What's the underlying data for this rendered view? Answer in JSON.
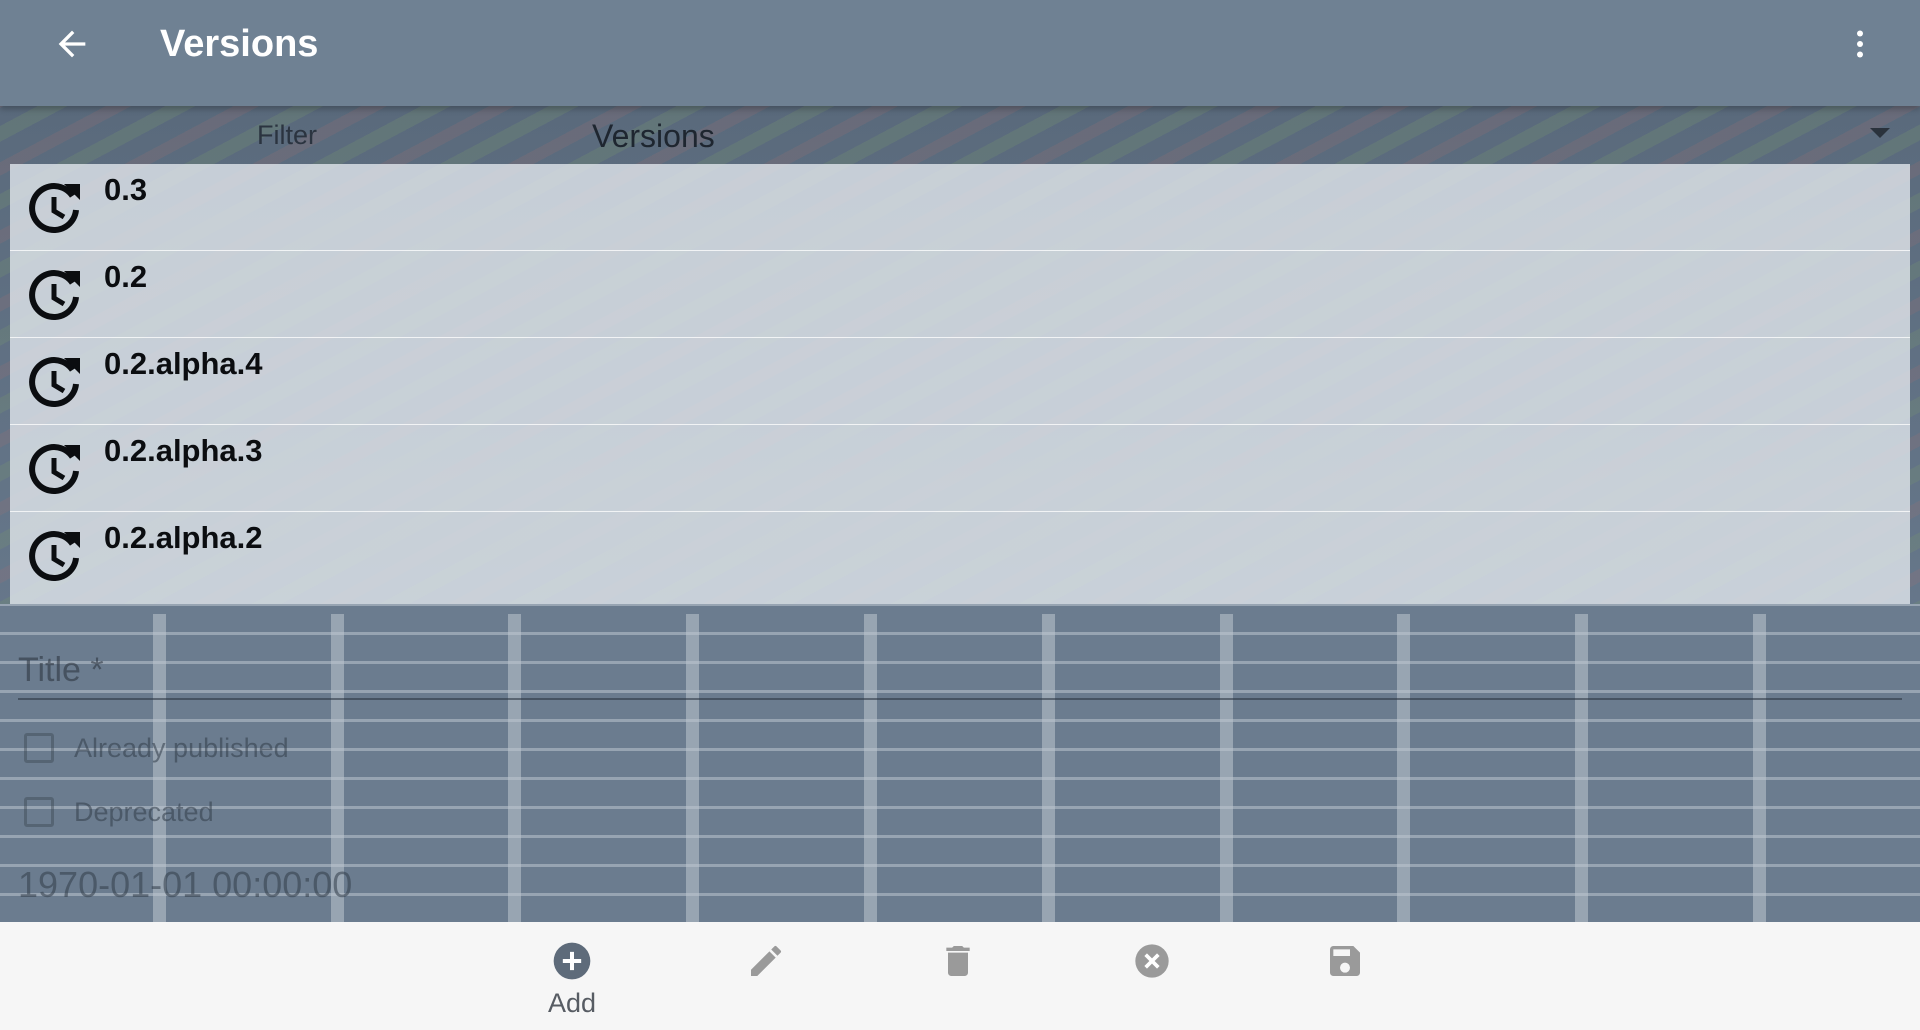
{
  "appbar": {
    "title": "Versions",
    "back_icon": "arrow-back-icon",
    "more_icon": "more-vert-icon"
  },
  "filter": {
    "label": "Filter",
    "selected": "Versions"
  },
  "versions": [
    {
      "label": "0.3",
      "icon": "history-icon"
    },
    {
      "label": "0.2",
      "icon": "history-icon"
    },
    {
      "label": "0.2.alpha.4",
      "icon": "history-icon"
    },
    {
      "label": "0.2.alpha.3",
      "icon": "history-icon"
    },
    {
      "label": "0.2.alpha.2",
      "icon": "history-icon"
    }
  ],
  "form": {
    "title_placeholder": "Title *",
    "already_published_label": "Already published",
    "deprecated_label": "Deprecated",
    "date": "1970-01-01 00:00:00"
  },
  "toolbar": {
    "add_label": "Add",
    "buttons": [
      "add-icon",
      "edit-icon",
      "delete-icon",
      "cancel-icon",
      "save-icon"
    ]
  },
  "colors": {
    "appbar": "#6f8193",
    "list_background": "#dee4ea",
    "toolbar_background": "#f6f6f6",
    "toolbar_icon": "#9a9a9a",
    "add_icon": "#5e6b7a"
  }
}
